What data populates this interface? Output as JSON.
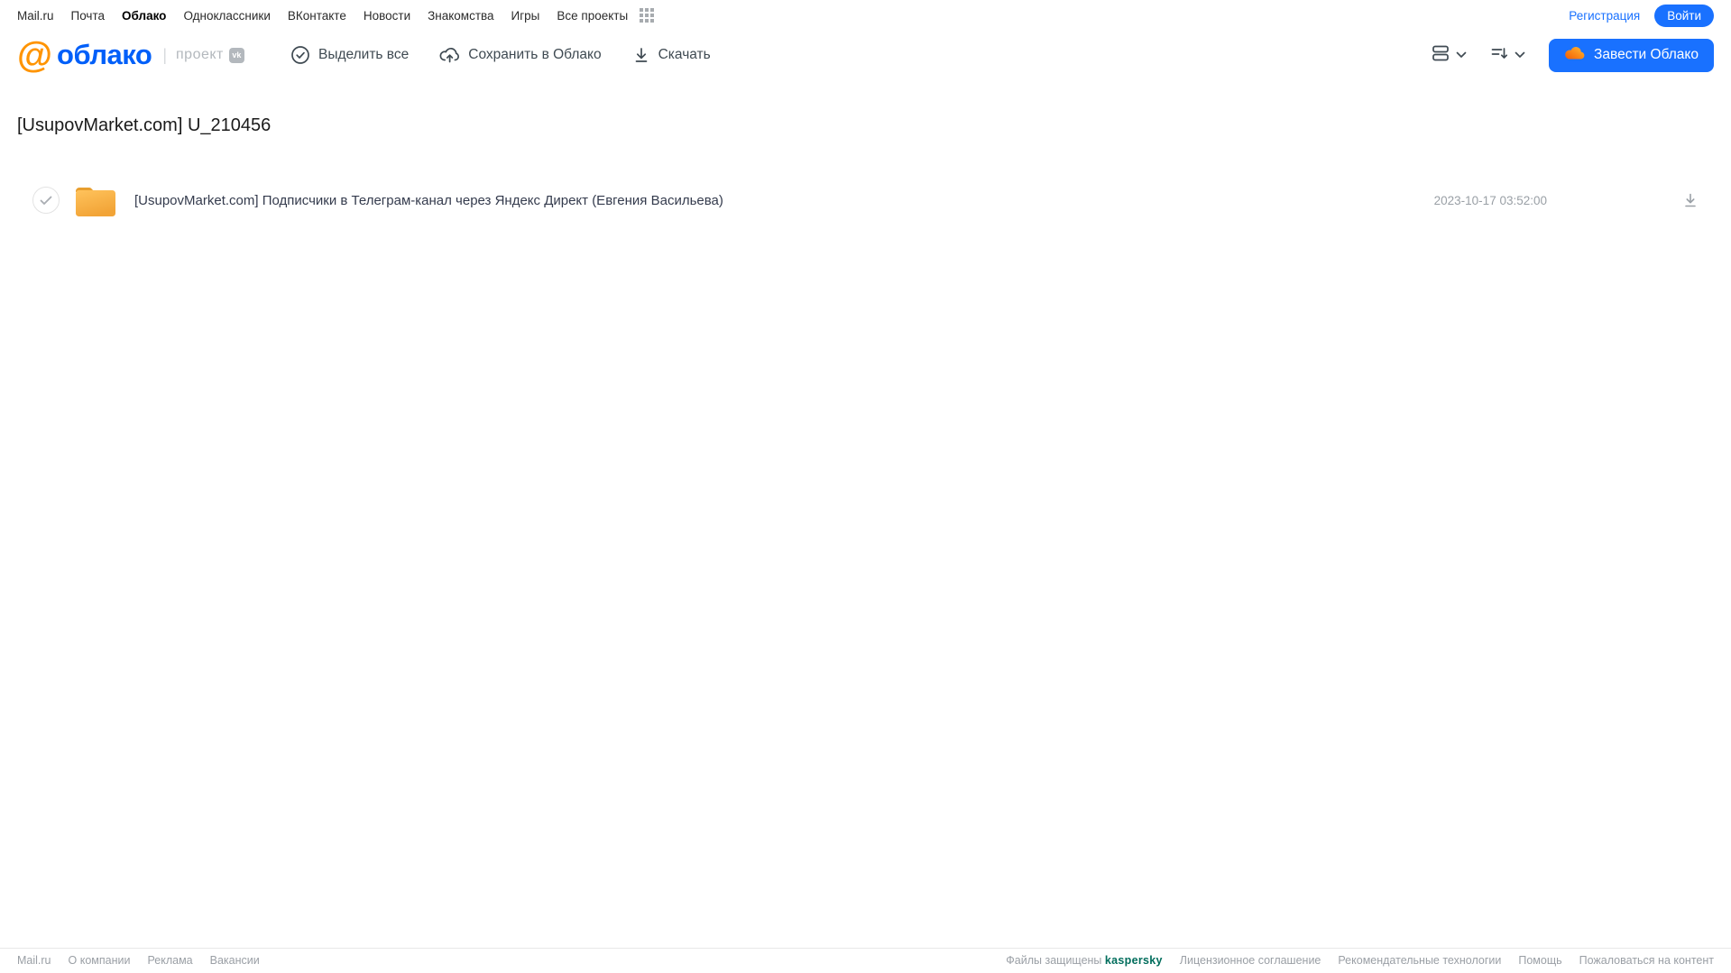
{
  "topnav": {
    "links": [
      "Mail.ru",
      "Почта",
      "Облако",
      "Одноклассники",
      "ВКонтакте",
      "Новости",
      "Знакомства",
      "Игры",
      "Все проекты"
    ],
    "registration": "Регистрация",
    "login": "Войти"
  },
  "header": {
    "logo_at": "@",
    "logo_text": "облако",
    "divider": "|",
    "project_label": "проект",
    "vk_badge": "vk",
    "toolbar": {
      "select_all": "Выделить все",
      "save_to_cloud": "Сохранить в Облако",
      "download": "Скачать"
    },
    "get_cloud_button": "Завести Облако"
  },
  "main": {
    "title": "[UsupovMarket.com] U_210456",
    "files": [
      {
        "name": "[UsupovMarket.com] Подписчики в Телеграм-канал через Яндекс Директ (Евгения Васильева)",
        "date": "2023-10-17 03:52:00"
      }
    ]
  },
  "footer": {
    "left_links": [
      "Mail.ru",
      "О компании",
      "Реклама",
      "Вакансии"
    ],
    "protected_label": "Файлы защищены",
    "kaspersky": "kaspersky",
    "right_links": [
      "Лицензионное соглашение",
      "Рекомендательные технологии",
      "Помощь",
      "Пожаловаться на контент"
    ]
  },
  "colors": {
    "accent_blue": "#1971ff",
    "logo_blue": "#005ff9",
    "logo_orange": "#ff9400",
    "folder_yellow": "#f6ab3e",
    "kaspersky_green": "#006d5c"
  }
}
